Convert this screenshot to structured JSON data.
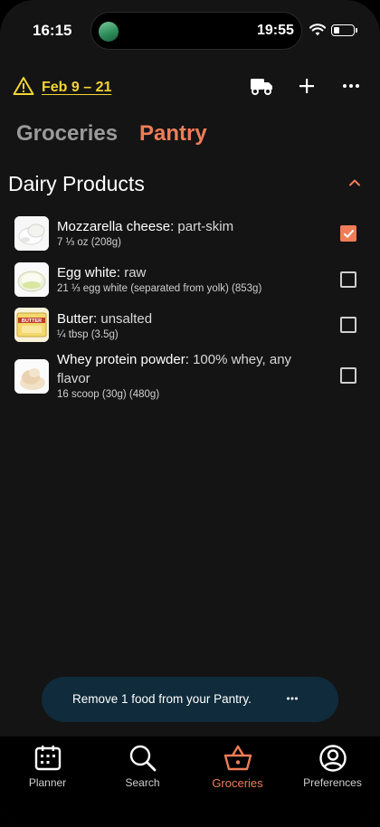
{
  "status_bar": {
    "time_left": "16:15",
    "time_right": "19:55"
  },
  "header": {
    "date_range": "Feb 9 – 21"
  },
  "tabs": [
    {
      "label": "Groceries",
      "active": false
    },
    {
      "label": "Pantry",
      "active": true
    }
  ],
  "section": {
    "title": "Dairy Products"
  },
  "items": [
    {
      "name": "Mozzarella cheese",
      "detail": "part-skim",
      "qty": "7 ⅓ oz (208g)",
      "checked": true,
      "icon": "mozzarella-icon"
    },
    {
      "name": "Egg white",
      "detail": "raw",
      "qty": "21 ⅓ egg white (separated from yolk) (853g)",
      "checked": false,
      "icon": "egg-white-icon"
    },
    {
      "name": "Butter",
      "detail": "unsalted",
      "qty": "¼ tbsp (3.5g)",
      "checked": false,
      "icon": "butter-icon"
    },
    {
      "name": "Whey protein powder",
      "detail": "100% whey, any flavor",
      "qty": "16 scoop (30g) (480g)",
      "checked": false,
      "icon": "whey-powder-icon"
    }
  ],
  "thumb_text": {
    "butter": "BUTTER"
  },
  "toast": {
    "text": "Remove 1 food from your Pantry."
  },
  "bottom_nav": [
    {
      "label": "Planner",
      "icon": "calendar-icon",
      "active": false
    },
    {
      "label": "Search",
      "icon": "search-icon",
      "active": false
    },
    {
      "label": "Groceries",
      "icon": "basket-icon",
      "active": true
    },
    {
      "label": "Preferences",
      "icon": "user-circle-icon",
      "active": false
    }
  ],
  "colors": {
    "accent": "#ef7d57",
    "warning": "#f2d433",
    "background": "#141414",
    "toast": "#102b3b"
  }
}
